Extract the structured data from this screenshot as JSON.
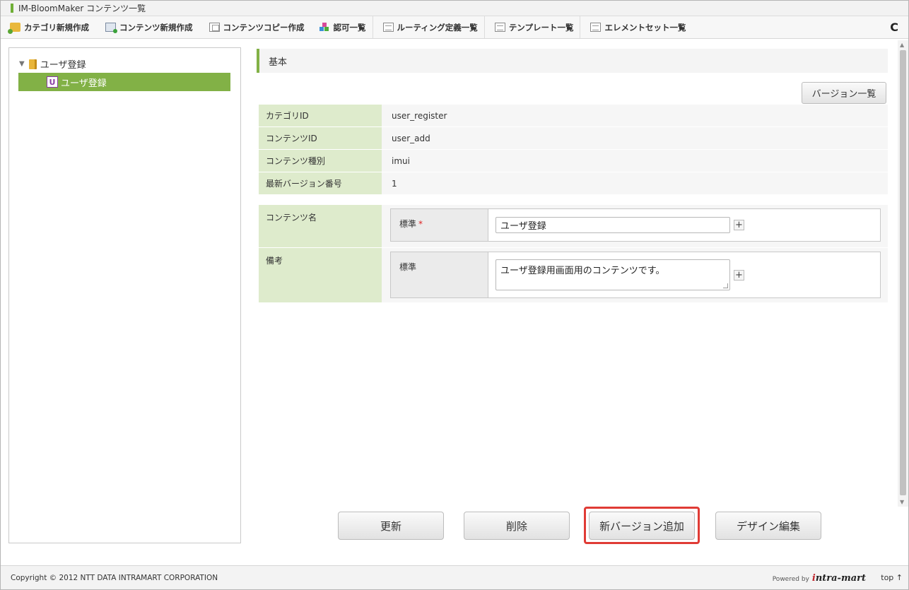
{
  "window": {
    "title": "IM-BloomMaker コンテンツ一覧"
  },
  "toolbar": {
    "items": [
      {
        "label": "カテゴリ新規作成",
        "icon": "folder-add-icon"
      },
      {
        "label": "コンテンツ新規作成",
        "icon": "page-add-icon"
      },
      {
        "label": "コンテンツコピー作成",
        "icon": "page-copy-icon"
      },
      {
        "label": "認可一覧",
        "icon": "blocks-icon"
      },
      {
        "label": "ルーティング定義一覧",
        "icon": "list-icon"
      },
      {
        "label": "テンプレート一覧",
        "icon": "list-icon"
      },
      {
        "label": "エレメントセット一覧",
        "icon": "list-icon"
      }
    ],
    "reload_icon": "C"
  },
  "tree": {
    "folder_label": "ユーザ登録",
    "selected_label": "ユーザ登録",
    "selected_icon_letter": "U"
  },
  "main": {
    "section_title": "基本",
    "version_list_button": "バージョン一覧",
    "info": [
      {
        "label": "カテゴリID",
        "value": "user_register"
      },
      {
        "label": "コンテンツID",
        "value": "user_add"
      },
      {
        "label": "コンテンツ種別",
        "value": "imui"
      },
      {
        "label": "最新バージョン番号",
        "value": "1"
      }
    ],
    "content_name": {
      "label": "コンテンツ名",
      "locale_label": "標準",
      "required_mark": "*",
      "value": "ユーザ登録"
    },
    "remarks": {
      "label": "備考",
      "locale_label": "標準",
      "value": "ユーザ登録用画面用のコンテンツです。"
    },
    "plus_label": "+"
  },
  "actions": {
    "update": "更新",
    "delete": "削除",
    "add_version": "新バージョン追加",
    "design_edit": "デザイン編集"
  },
  "footer": {
    "copyright": "Copyright © 2012 NTT DATA INTRAMART CORPORATION",
    "powered_by": "Powered by",
    "brand_i": "i",
    "brand_rest": "ntra-mart",
    "top_link": "top ↑"
  },
  "colors": {
    "accent_green": "#82b146",
    "label_bg": "#deebcc",
    "highlight_red": "#e03b35"
  }
}
